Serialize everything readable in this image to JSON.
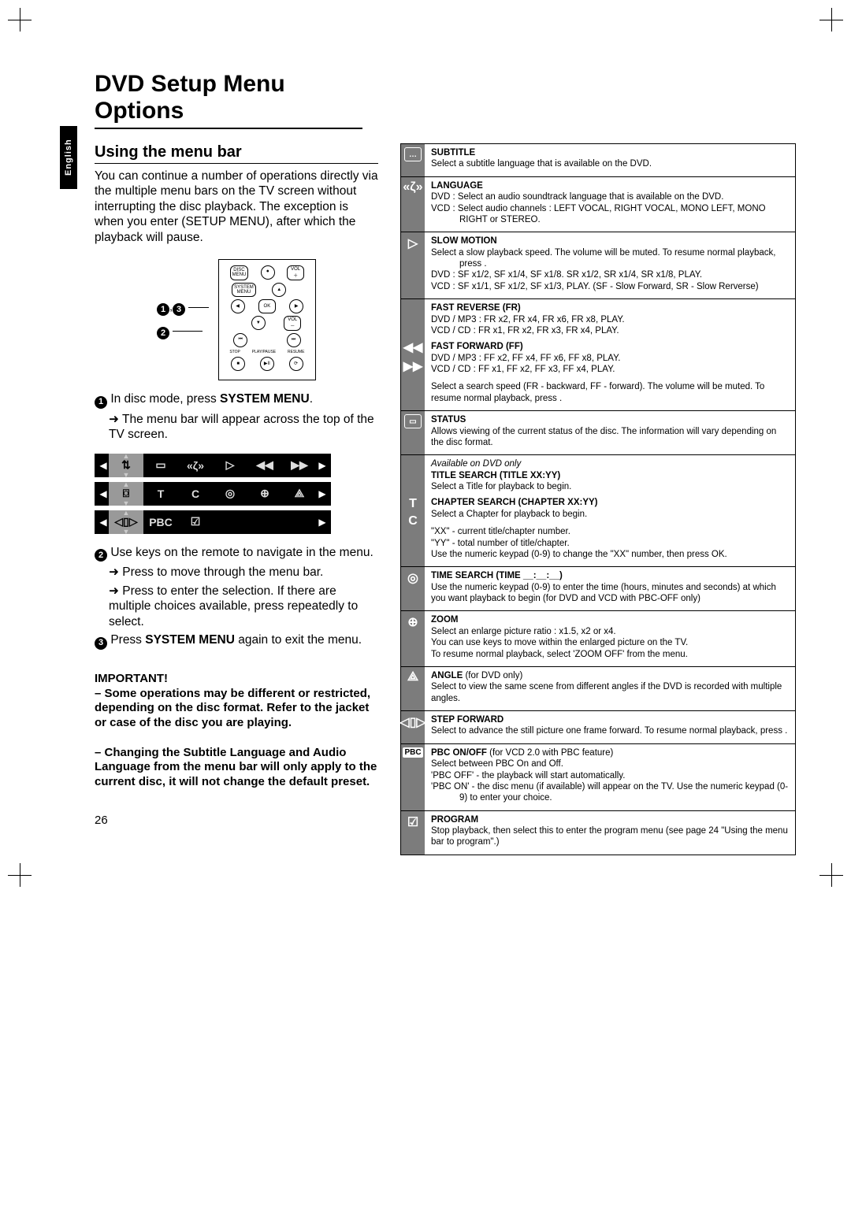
{
  "page": {
    "title": "DVD Setup Menu Options",
    "lang_tab": "English",
    "page_number": "26"
  },
  "left": {
    "section_title": "Using the menu bar",
    "intro": "You can continue a number of operations directly via the multiple menu bars on the TV screen without interrupting the disc playback. The exception is when you enter      (SETUP MENU), after which the playback will pause.",
    "remote_callout": "1 , 3",
    "remote_callout2": "2",
    "step1_pre": "In disc mode, press ",
    "step1_bold": "SYSTEM MENU",
    "step1_post": ".",
    "step1_arrow": "The menu bar will appear across the top of the TV screen.",
    "menubar_rows": [
      [
        "⇅",
        "▭",
        "«ζ»",
        "▷",
        "◀◀",
        "▶▶"
      ],
      [
        "⌼",
        "T",
        "C",
        "◎",
        "⊕",
        "⟁"
      ],
      [
        "◁▯▷",
        "PBC",
        "☑"
      ]
    ],
    "step2": "Use              keys on the remote to navigate in the menu.",
    "step2_arrow1": "Press       to move through the menu bar.",
    "step2_arrow2": "Press    to enter the selection.  If there are multiple choices available, press repeatedly to select.",
    "step3_pre": "Press ",
    "step3_bold": "SYSTEM MENU",
    "step3_post": " again to exit the menu.",
    "important_label": "IMPORTANT!",
    "important_1": "–  Some operations may be different or restricted, depending on the disc format. Refer to the jacket or case of the disc you are playing.",
    "important_2": "–  Changing the Subtitle Language and Audio Language from the menu bar will only apply to the current disc, it will not change the default preset."
  },
  "right": [
    {
      "icon": "▭",
      "title": "SUBTITLE",
      "body": "Select a subtitle language that is available on the DVD."
    },
    {
      "icon": "«ζ»",
      "title": "LANGUAGE",
      "body_lines": [
        "DVD : Select an audio soundtrack language that is available on the DVD.",
        "VCD : Select audio channels : LEFT VOCAL, RIGHT VOCAL, MONO LEFT, MONO RIGHT or STEREO."
      ]
    },
    {
      "icon": "▷",
      "title": "SLOW MOTION",
      "body_lines": [
        "Select a slow playback speed. The volume will be muted.  To resume normal playback, press      .",
        "DVD : SF x1/2, SF x1/4, SF x1/8. SR x1/2, SR x1/4, SR x1/8, PLAY.",
        "VCD : SF x1/1, SF x1/2, SF x1/3, PLAY. (SF - Slow Forward, SR - Slow Rerverse)"
      ]
    },
    {
      "icon": "◀◀▶▶",
      "sections": [
        {
          "title": "FAST REVERSE (FR)",
          "body": "DVD / MP3 : FR x2, FR x4, FR x6, FR x8, PLAY.\nVCD / CD : FR x1, FR x2, FR x3, FR x4, PLAY."
        },
        {
          "title": "FAST FORWARD (FF)",
          "body": "DVD / MP3 : FF x2, FF x4, FF x6, FF x8, PLAY.\nVCD / CD : FF x1, FF x2, FF x3, FF x4, PLAY."
        }
      ],
      "tail": "Select a search speed (FR - backward, FF - forward). The volume will be muted.  To resume normal playback, press      ."
    },
    {
      "icon": "⌼",
      "title": "STATUS",
      "body": "Allows viewing of the current status of the disc. The information will vary depending on the disc format."
    },
    {
      "icon": "TC",
      "note": "Available on DVD only",
      "sections": [
        {
          "title": "TITLE SEARCH (TITLE XX:YY)",
          "body": "Select a Title for playback to begin."
        },
        {
          "title": "CHAPTER SEARCH (CHAPTER XX:YY)",
          "body": "Select a Chapter for playback to begin."
        }
      ],
      "tail_lines": [
        "\"XX\" - current title/chapter number.",
        "\"YY\" - total number of title/chapter.",
        "Use the numeric keypad (0-9) to change the \"XX\" number, then press OK."
      ]
    },
    {
      "icon": "◎",
      "title": "TIME SEARCH (TIME __:__:__)",
      "body": "Use the numeric keypad (0-9) to enter the time (hours, minutes and seconds) at which you want playback to begin (for DVD and VCD with PBC-OFF only)"
    },
    {
      "icon": "⊕",
      "title": "ZOOM",
      "body_lines": [
        "Select an enlarge picture ratio : x1.5, x2 or x4.",
        "You can use             keys to move within the enlarged picture on the TV.",
        "To resume normal playback, select 'ZOOM OFF' from the menu."
      ]
    },
    {
      "icon": "⟁",
      "title_html": "ANGLE (for DVD only)",
      "body": "Select to view the same scene from different angles if the DVD is recorded with multiple angles."
    },
    {
      "icon": "◁▯▷",
      "title": "STEP FORWARD",
      "body": "Select to advance the still picture one frame forward. To resume normal playback, press      ."
    },
    {
      "icon": "PBC",
      "title_html": "PBC ON/OFF (for VCD 2.0 with PBC feature)",
      "body_lines": [
        "Select between PBC On and Off.",
        "'PBC OFF' - the playback will start automatically.",
        "'PBC ON' - the disc menu (if available) will appear on the TV.  Use the numeric keypad (0-9) to enter your choice."
      ]
    },
    {
      "icon": "☑",
      "title": "PROGRAM",
      "body": "Stop playback, then select this to enter the program menu (see page 24 \"Using the menu bar to program\".)"
    }
  ]
}
